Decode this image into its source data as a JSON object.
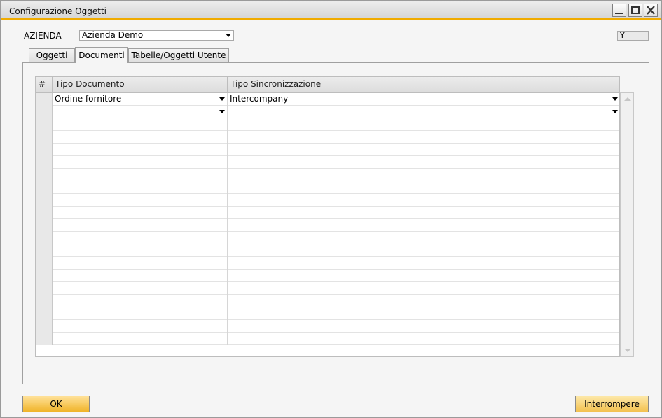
{
  "window": {
    "title": "Configurazione Oggetti"
  },
  "header": {
    "azienda_label": "AZIENDA",
    "azienda_value": "Azienda Demo",
    "flag_value": "Y"
  },
  "tabs": [
    {
      "label": "Oggetti",
      "active": false
    },
    {
      "label": "Documenti",
      "active": true
    },
    {
      "label": "Tabelle/Oggetti Utente",
      "active": false
    }
  ],
  "grid": {
    "columns": [
      "#",
      "Tipo Documento",
      "Tipo Sincronizzazione"
    ],
    "rows": [
      {
        "tipo_documento": "Ordine fornitore",
        "tipo_sincronizzazione": "Intercompany"
      },
      {
        "tipo_documento": "",
        "tipo_sincronizzazione": ""
      }
    ],
    "empty_row_count": 18
  },
  "buttons": {
    "ok": "OK",
    "cancel": "Interrompere"
  },
  "colors": {
    "accent": "#f0ab00",
    "button": "#f3c14f"
  }
}
